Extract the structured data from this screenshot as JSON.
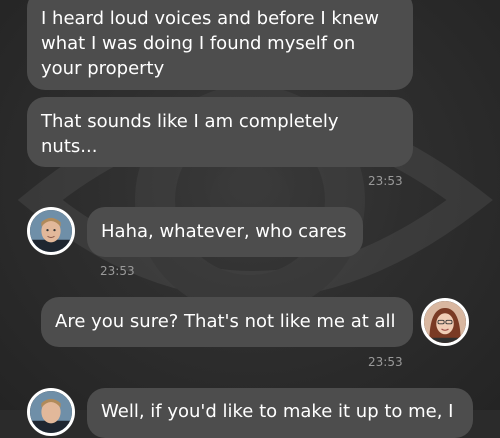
{
  "messages": [
    {
      "text": "I heard loud voices and before I knew what I was doing I found myself on your property",
      "time": ""
    },
    {
      "text": "That sounds like I am completely nuts...",
      "time": "23:53"
    },
    {
      "text": "Haha, whatever, who cares",
      "time": "23:53"
    },
    {
      "text": "Are you sure? That's not like me at all",
      "time": "23:53"
    },
    {
      "text": "Well, if you'd like to make it up to me, I",
      "time": ""
    }
  ],
  "avatars": {
    "contact": "male-avatar",
    "self": "female-avatar"
  },
  "colors": {
    "background": "#2b2b2b",
    "bubble": "#4d4d4d",
    "text": "#ffffff",
    "timestamp": "#9a9a9a"
  }
}
